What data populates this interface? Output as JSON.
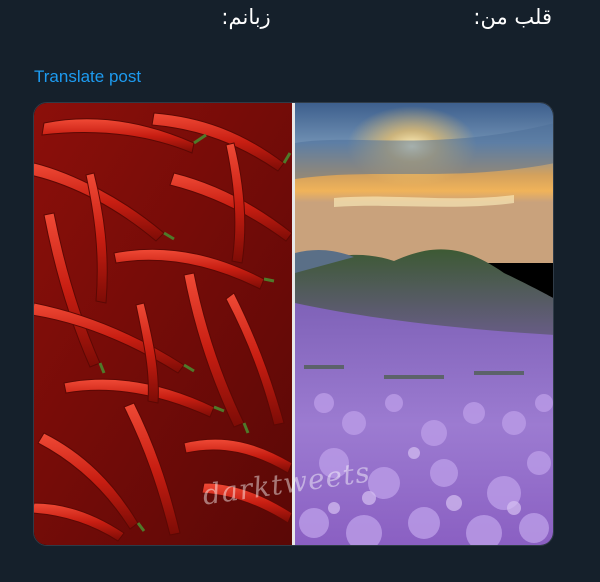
{
  "post": {
    "text_heart": "قلب من:",
    "text_tongue": "زبانم:",
    "translate_label": "Translate post",
    "watermark": "darktweets"
  },
  "media": {
    "left_subject": "red-chili-peppers",
    "right_subject": "purple-flower-hillside-sunset"
  },
  "colors": {
    "background": "#15202b",
    "link": "#1d9bf0",
    "text": "#ffffff"
  }
}
